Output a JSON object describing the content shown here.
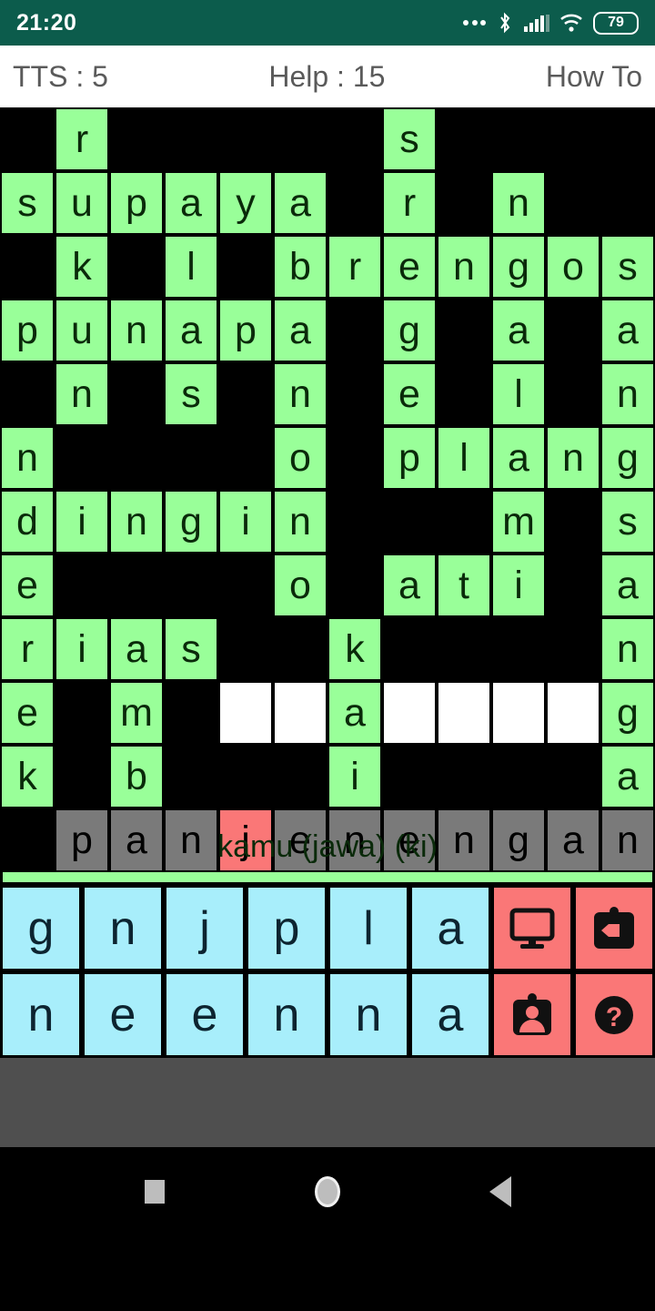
{
  "status_bar": {
    "time": "21:20",
    "battery_percent": "79",
    "icons": [
      "more-dots-icon",
      "bluetooth-icon",
      "signal-bars-icon",
      "wifi-icon",
      "battery-icon"
    ]
  },
  "app_bar": {
    "tts_label": "TTS : 5",
    "help_label": "Help : 15",
    "how_to_label": "How To"
  },
  "grid": {
    "columns": 12,
    "rows": 11,
    "colors": {
      "filled": "#99ff99",
      "blank": "#000000",
      "empty": "#ffffff",
      "current_word": "#7a7a7a",
      "cursor": "#fa7777"
    },
    "cells": [
      [
        {
          "t": "",
          "s": "blank"
        },
        {
          "t": "r",
          "s": "filled"
        },
        {
          "t": "",
          "s": "blank"
        },
        {
          "t": "",
          "s": "blank"
        },
        {
          "t": "",
          "s": "blank"
        },
        {
          "t": "",
          "s": "blank"
        },
        {
          "t": "",
          "s": "blank"
        },
        {
          "t": "s",
          "s": "filled"
        },
        {
          "t": "",
          "s": "blank"
        },
        {
          "t": "",
          "s": "blank"
        },
        {
          "t": "",
          "s": "blank"
        },
        {
          "t": "",
          "s": "blank"
        }
      ],
      [
        {
          "t": "s",
          "s": "filled"
        },
        {
          "t": "u",
          "s": "filled"
        },
        {
          "t": "p",
          "s": "filled"
        },
        {
          "t": "a",
          "s": "filled"
        },
        {
          "t": "y",
          "s": "filled"
        },
        {
          "t": "a",
          "s": "filled"
        },
        {
          "t": "",
          "s": "blank"
        },
        {
          "t": "r",
          "s": "filled"
        },
        {
          "t": "",
          "s": "blank"
        },
        {
          "t": "n",
          "s": "filled"
        },
        {
          "t": "",
          "s": "blank"
        },
        {
          "t": "",
          "s": "blank"
        }
      ],
      [
        {
          "t": "",
          "s": "blank"
        },
        {
          "t": "k",
          "s": "filled"
        },
        {
          "t": "",
          "s": "blank"
        },
        {
          "t": "l",
          "s": "filled"
        },
        {
          "t": "",
          "s": "blank"
        },
        {
          "t": "b",
          "s": "filled"
        },
        {
          "t": "r",
          "s": "filled"
        },
        {
          "t": "e",
          "s": "filled"
        },
        {
          "t": "n",
          "s": "filled"
        },
        {
          "t": "g",
          "s": "filled"
        },
        {
          "t": "o",
          "s": "filled"
        },
        {
          "t": "s",
          "s": "filled"
        }
      ],
      [
        {
          "t": "p",
          "s": "filled"
        },
        {
          "t": "u",
          "s": "filled"
        },
        {
          "t": "n",
          "s": "filled"
        },
        {
          "t": "a",
          "s": "filled"
        },
        {
          "t": "p",
          "s": "filled"
        },
        {
          "t": "a",
          "s": "filled"
        },
        {
          "t": "",
          "s": "blank"
        },
        {
          "t": "g",
          "s": "filled"
        },
        {
          "t": "",
          "s": "blank"
        },
        {
          "t": "a",
          "s": "filled"
        },
        {
          "t": "",
          "s": "blank"
        },
        {
          "t": "a",
          "s": "filled"
        }
      ],
      [
        {
          "t": "",
          "s": "blank"
        },
        {
          "t": "n",
          "s": "filled"
        },
        {
          "t": "",
          "s": "blank"
        },
        {
          "t": "s",
          "s": "filled"
        },
        {
          "t": "",
          "s": "blank"
        },
        {
          "t": "n",
          "s": "filled"
        },
        {
          "t": "",
          "s": "blank"
        },
        {
          "t": "e",
          "s": "filled"
        },
        {
          "t": "",
          "s": "blank"
        },
        {
          "t": "l",
          "s": "filled"
        },
        {
          "t": "",
          "s": "blank"
        },
        {
          "t": "n",
          "s": "filled"
        }
      ],
      [
        {
          "t": "n",
          "s": "filled"
        },
        {
          "t": "",
          "s": "blank"
        },
        {
          "t": "",
          "s": "blank"
        },
        {
          "t": "",
          "s": "blank"
        },
        {
          "t": "",
          "s": "blank"
        },
        {
          "t": "o",
          "s": "filled"
        },
        {
          "t": "",
          "s": "blank"
        },
        {
          "t": "p",
          "s": "filled"
        },
        {
          "t": "l",
          "s": "filled"
        },
        {
          "t": "a",
          "s": "filled"
        },
        {
          "t": "n",
          "s": "filled"
        },
        {
          "t": "g",
          "s": "filled"
        }
      ],
      [
        {
          "t": "d",
          "s": "filled"
        },
        {
          "t": "i",
          "s": "filled"
        },
        {
          "t": "n",
          "s": "filled"
        },
        {
          "t": "g",
          "s": "filled"
        },
        {
          "t": "i",
          "s": "filled"
        },
        {
          "t": "n",
          "s": "filled"
        },
        {
          "t": "",
          "s": "blank"
        },
        {
          "t": "",
          "s": "blank"
        },
        {
          "t": "",
          "s": "blank"
        },
        {
          "t": "m",
          "s": "filled"
        },
        {
          "t": "",
          "s": "blank"
        },
        {
          "t": "s",
          "s": "filled"
        }
      ],
      [
        {
          "t": "e",
          "s": "filled"
        },
        {
          "t": "",
          "s": "blank"
        },
        {
          "t": "",
          "s": "blank"
        },
        {
          "t": "",
          "s": "blank"
        },
        {
          "t": "",
          "s": "blank"
        },
        {
          "t": "o",
          "s": "filled"
        },
        {
          "t": "",
          "s": "blank"
        },
        {
          "t": "a",
          "s": "filled"
        },
        {
          "t": "t",
          "s": "filled"
        },
        {
          "t": "i",
          "s": "filled"
        },
        {
          "t": "",
          "s": "blank"
        },
        {
          "t": "a",
          "s": "filled"
        }
      ],
      [
        {
          "t": "r",
          "s": "filled"
        },
        {
          "t": "i",
          "s": "filled"
        },
        {
          "t": "a",
          "s": "filled"
        },
        {
          "t": "s",
          "s": "filled"
        },
        {
          "t": "",
          "s": "blank"
        },
        {
          "t": "",
          "s": "blank"
        },
        {
          "t": "k",
          "s": "filled"
        },
        {
          "t": "",
          "s": "blank"
        },
        {
          "t": "",
          "s": "blank"
        },
        {
          "t": "",
          "s": "blank"
        },
        {
          "t": "",
          "s": "blank"
        },
        {
          "t": "n",
          "s": "filled"
        }
      ],
      [
        {
          "t": "e",
          "s": "filled"
        },
        {
          "t": "",
          "s": "blank"
        },
        {
          "t": "m",
          "s": "filled"
        },
        {
          "t": "",
          "s": "blank"
        },
        {
          "t": "",
          "s": "empty"
        },
        {
          "t": "",
          "s": "empty"
        },
        {
          "t": "a",
          "s": "filled"
        },
        {
          "t": "",
          "s": "empty"
        },
        {
          "t": "",
          "s": "empty"
        },
        {
          "t": "",
          "s": "empty"
        },
        {
          "t": "",
          "s": "empty"
        },
        {
          "t": "g",
          "s": "filled"
        }
      ],
      [
        {
          "t": "k",
          "s": "filled"
        },
        {
          "t": "",
          "s": "blank"
        },
        {
          "t": "b",
          "s": "filled"
        },
        {
          "t": "",
          "s": "blank"
        },
        {
          "t": "",
          "s": "blank"
        },
        {
          "t": "",
          "s": "blank"
        },
        {
          "t": "i",
          "s": "filled"
        },
        {
          "t": "",
          "s": "blank"
        },
        {
          "t": "",
          "s": "blank"
        },
        {
          "t": "",
          "s": "blank"
        },
        {
          "t": "",
          "s": "blank"
        },
        {
          "t": "a",
          "s": "filled"
        }
      ],
      [
        {
          "t": "",
          "s": "blank"
        },
        {
          "t": "p",
          "s": "current"
        },
        {
          "t": "a",
          "s": "current"
        },
        {
          "t": "n",
          "s": "current"
        },
        {
          "t": "j",
          "s": "cursor"
        },
        {
          "t": "e",
          "s": "current"
        },
        {
          "t": "n",
          "s": "current"
        },
        {
          "t": "e",
          "s": "current"
        },
        {
          "t": "n",
          "s": "current"
        },
        {
          "t": "g",
          "s": "current"
        },
        {
          "t": "a",
          "s": "current"
        },
        {
          "t": "n",
          "s": "current"
        }
      ]
    ]
  },
  "clue": {
    "text": "kamu (jawa) (ki)"
  },
  "keyboard": {
    "row1": [
      {
        "label": "g",
        "type": "letter",
        "name": "key-g"
      },
      {
        "label": "n",
        "type": "letter",
        "name": "key-n-1"
      },
      {
        "label": "j",
        "type": "letter",
        "name": "key-j"
      },
      {
        "label": "p",
        "type": "letter",
        "name": "key-p"
      },
      {
        "label": "l",
        "type": "letter",
        "name": "key-l"
      },
      {
        "label": "a",
        "type": "letter",
        "name": "key-a-1"
      },
      {
        "label": "",
        "type": "action",
        "name": "monitor-icon"
      },
      {
        "label": "",
        "type": "action",
        "name": "backspace-badge-icon"
      }
    ],
    "row2": [
      {
        "label": "n",
        "type": "letter",
        "name": "key-n-2"
      },
      {
        "label": "e",
        "type": "letter",
        "name": "key-e-1"
      },
      {
        "label": "e",
        "type": "letter",
        "name": "key-e-2"
      },
      {
        "label": "n",
        "type": "letter",
        "name": "key-n-3"
      },
      {
        "label": "n",
        "type": "letter",
        "name": "key-n-4"
      },
      {
        "label": "a",
        "type": "letter",
        "name": "key-a-2"
      },
      {
        "label": "",
        "type": "action",
        "name": "person-badge-icon"
      },
      {
        "label": "",
        "type": "action",
        "name": "question-mark-icon"
      }
    ]
  },
  "nav_bar": {
    "items": [
      "recents-square-icon",
      "home-circle-icon",
      "back-triangle-icon"
    ]
  }
}
